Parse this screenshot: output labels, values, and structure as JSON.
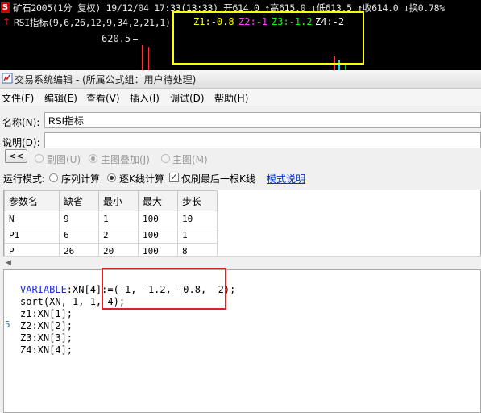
{
  "chart": {
    "symbol_badge": "S",
    "info_line": "矿石2005(1分 复权) 19/12/04 17:33(13:33) 开614.0 ↑高615.0 ↓低613.5 ↑收614.0 ↓换0.78%",
    "indicator_name": "RSI指标(9,6,26,12,9,34,2,21,1)",
    "z1": "Z1:-0.8",
    "z2": "Z2:-1",
    "z3": "Z3:-1.2",
    "z4": "Z4:-2",
    "price_label": "620.5",
    "colors": {
      "background": "#000000",
      "z1": "#ffff00",
      "z2": "#ff40ff",
      "z3": "#00ff00",
      "z4": "#ffffff",
      "highlight_box": "#ffff00"
    }
  },
  "window": {
    "title": "交易系统编辑 - (所属公式组：用户待处理)",
    "menu": [
      "文件(F)",
      "编辑(E)",
      "查看(V)",
      "插入(I)",
      "调试(D)",
      "帮助(H)"
    ]
  },
  "form": {
    "name_label": "名称(N):",
    "name_value": "RSI指标",
    "desc_label": "说明(D):",
    "desc_value": "",
    "collapse_button": "<<",
    "display_options": [
      {
        "label": "副图(U)",
        "selected": false
      },
      {
        "label": "主图叠加(J)",
        "selected": true
      },
      {
        "label": "主图(M)",
        "selected": false
      }
    ],
    "run_mode_label": "运行模式:",
    "run_mode_sequence": "序列计算",
    "run_mode_kline": "逐K线计算",
    "refresh_last_only": "仅刷最后一根K线",
    "refresh_last_only_checked": true,
    "mode_help_link": "模式说明"
  },
  "params": {
    "headers": [
      "参数名",
      "缺省",
      "最小",
      "最大",
      "步长"
    ],
    "rows": [
      [
        "N",
        "9",
        "1",
        "100",
        "10"
      ],
      [
        "P1",
        "6",
        "2",
        "100",
        "1"
      ],
      [
        "P",
        "26",
        "20",
        "100",
        "8"
      ]
    ]
  },
  "code": {
    "line_number": "5",
    "line1_kw": "VARIABLE",
    "line1_rest": ":XN[4]:=(-1, -1.2, -0.8, -2);",
    "line2": "sort(XN, 1, 1, 4);",
    "line3": "z1:XN[1];",
    "line4": "Z2:XN[2];",
    "line5": "Z3:XN[3];",
    "line6": "Z4:XN[4];",
    "highlight_box_color": "#e02020"
  }
}
